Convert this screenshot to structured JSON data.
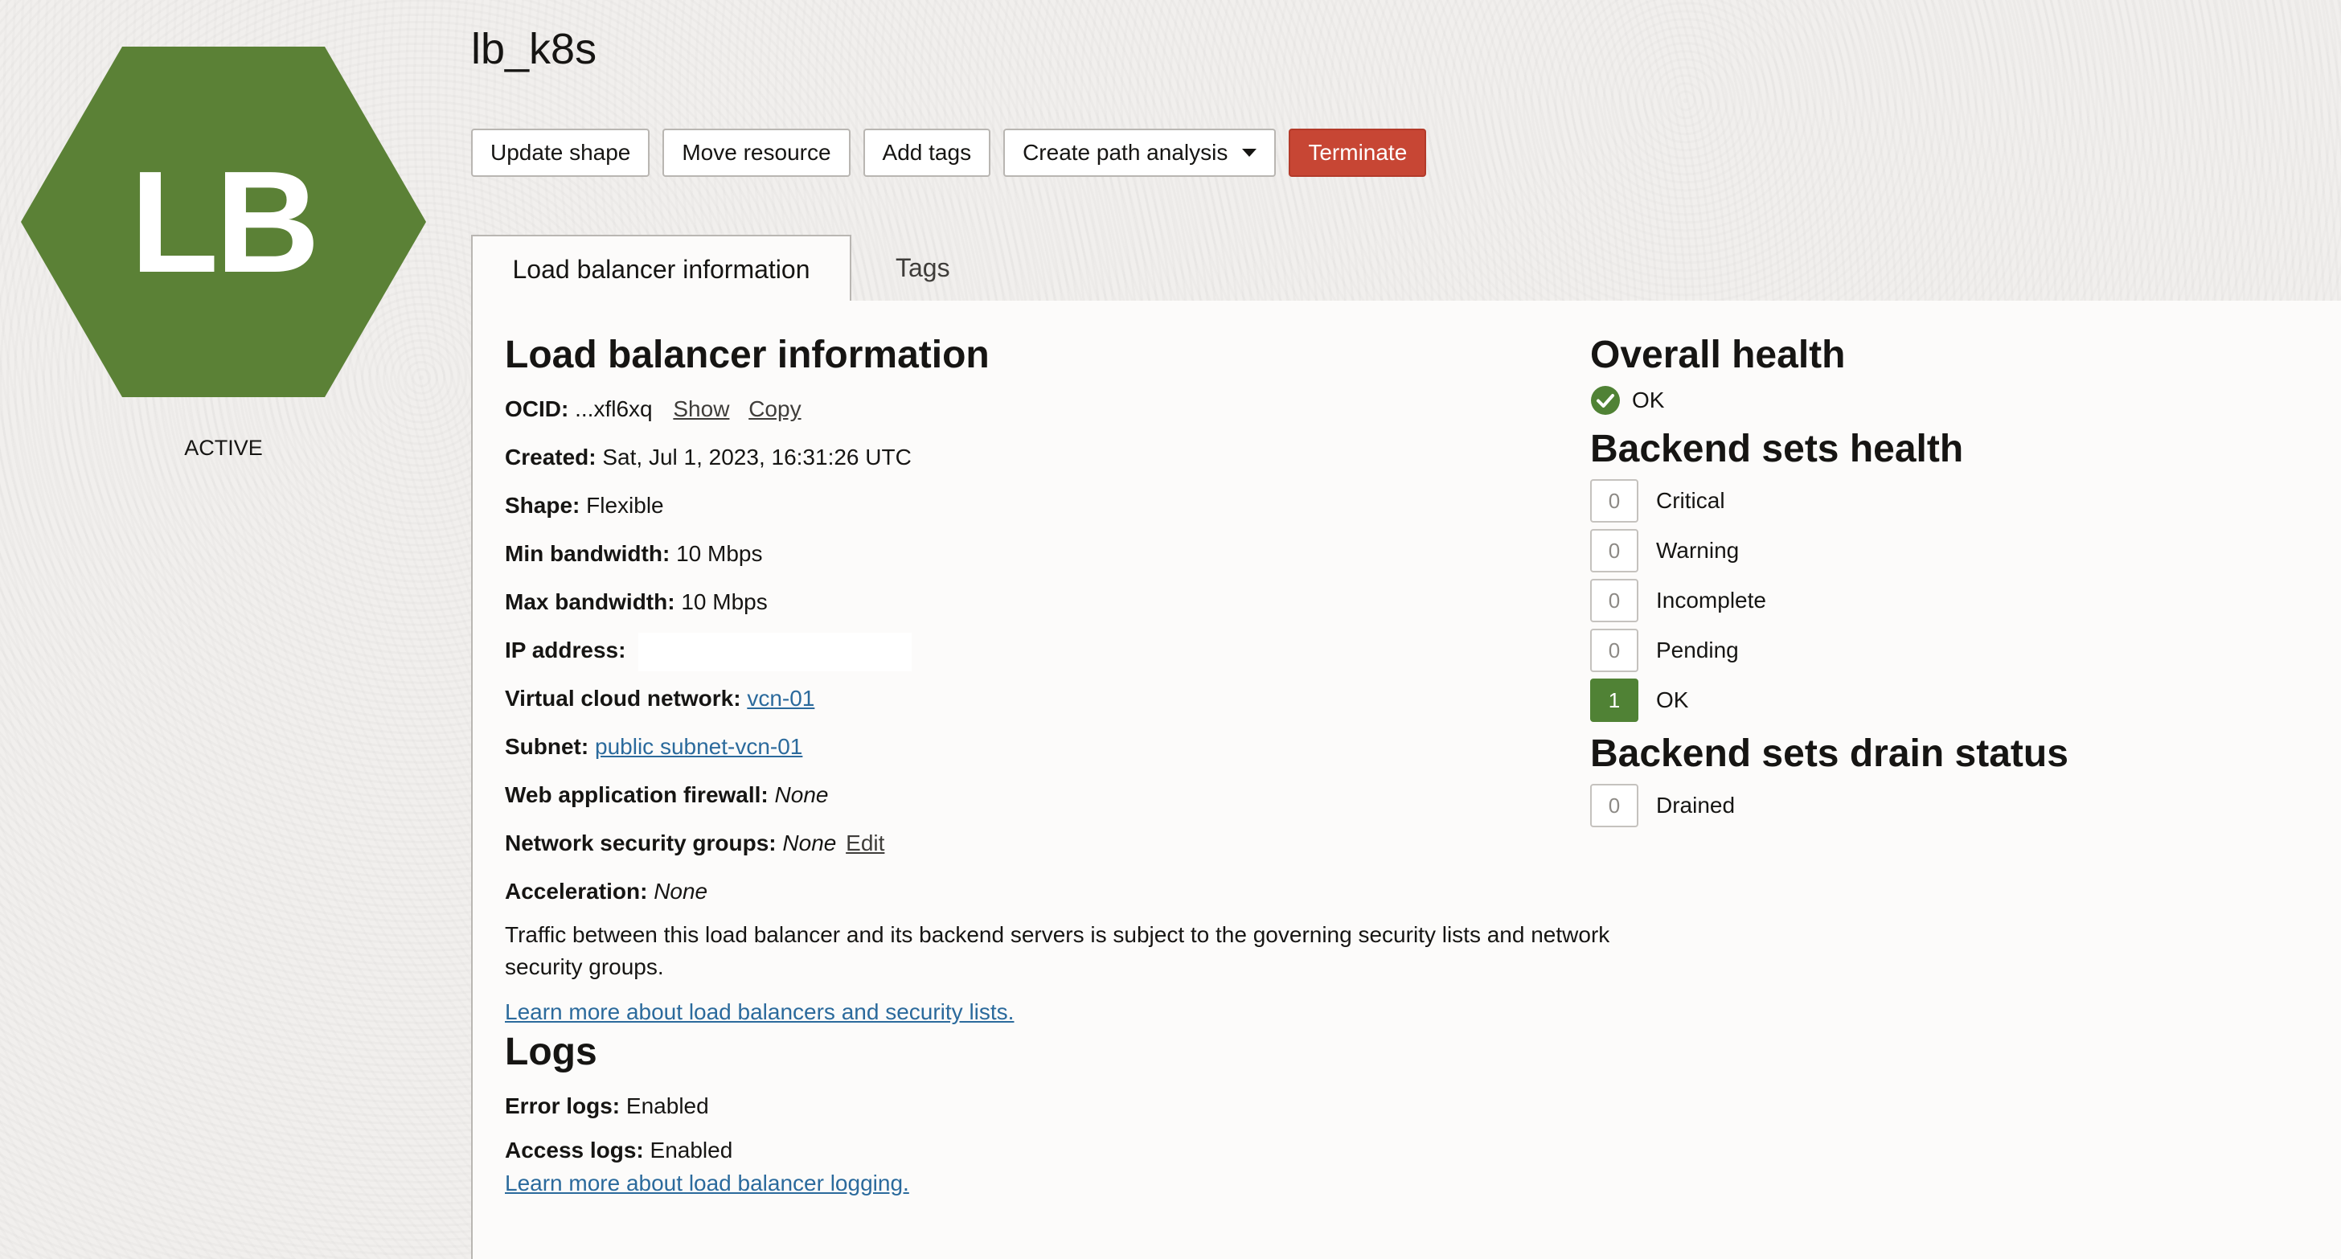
{
  "badge": {
    "initials": "LB",
    "state": "ACTIVE",
    "color": "#5b8136"
  },
  "page": {
    "title": "lb_k8s"
  },
  "toolbar": {
    "update_shape": "Update shape",
    "move_resource": "Move resource",
    "add_tags": "Add tags",
    "create_path_analysis": "Create path analysis",
    "terminate": "Terminate"
  },
  "tabs": [
    {
      "label": "Load balancer information"
    },
    {
      "label": "Tags"
    }
  ],
  "info": {
    "heading": "Load balancer information",
    "ocid": {
      "label": "OCID:",
      "value": "...xfl6xq",
      "show": "Show",
      "copy": "Copy"
    },
    "created": {
      "label": "Created:",
      "value": "Sat, Jul 1, 2023, 16:31:26 UTC"
    },
    "shape": {
      "label": "Shape:",
      "value": "Flexible"
    },
    "min_bandwidth": {
      "label": "Min bandwidth:",
      "value": "10 Mbps"
    },
    "max_bandwidth": {
      "label": "Max bandwidth:",
      "value": "10 Mbps"
    },
    "ip_address": {
      "label": "IP address:"
    },
    "vcn": {
      "label": "Virtual cloud network:",
      "value": "vcn-01"
    },
    "subnet": {
      "label": "Subnet:",
      "value": "public subnet-vcn-01"
    },
    "waf": {
      "label": "Web application firewall:",
      "value": "None"
    },
    "nsg": {
      "label": "Network security groups:",
      "value": "None",
      "edit": "Edit"
    },
    "acceleration": {
      "label": "Acceleration:",
      "value": "None"
    },
    "note": "Traffic between this load balancer and its backend servers is subject to the governing security lists and network security groups.",
    "learn_link": "Learn more about load balancers and security lists."
  },
  "logs": {
    "heading": "Logs",
    "error": {
      "label": "Error logs:",
      "value": "Enabled"
    },
    "access": {
      "label": "Access logs:",
      "value": "Enabled"
    },
    "learn_link": "Learn more about load balancer logging."
  },
  "health": {
    "overall_heading": "Overall health",
    "overall_status": "OK",
    "backend_heading": "Backend sets health",
    "backend": [
      {
        "count": "0",
        "label": "Critical"
      },
      {
        "count": "0",
        "label": "Warning"
      },
      {
        "count": "0",
        "label": "Incomplete"
      },
      {
        "count": "0",
        "label": "Pending"
      },
      {
        "count": "1",
        "label": "OK"
      }
    ],
    "drain_heading": "Backend sets drain status",
    "drain": [
      {
        "count": "0",
        "label": "Drained"
      }
    ]
  }
}
